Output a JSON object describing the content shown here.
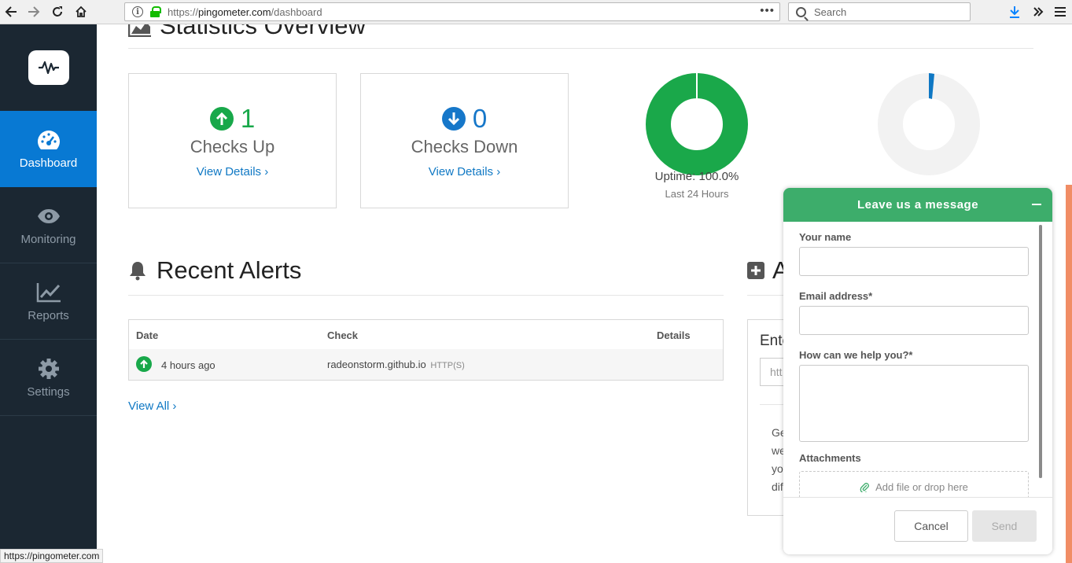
{
  "browser": {
    "url_prefix": "https://",
    "url_domain": "pingometer.com",
    "url_path": "/dashboard",
    "search_placeholder": "Search",
    "status_url": "https://pingometer.com"
  },
  "sidebar": {
    "items": [
      {
        "label": "Dashboard",
        "icon": "dashboard-gauge-icon",
        "active": true
      },
      {
        "label": "Monitoring",
        "icon": "eye-icon",
        "active": false
      },
      {
        "label": "Reports",
        "icon": "chart-icon",
        "active": false
      },
      {
        "label": "Settings",
        "icon": "gear-icon",
        "active": false
      }
    ]
  },
  "stats": {
    "heading": "Statistics Overview",
    "checks_up": {
      "count": "1",
      "label": "Checks Up",
      "link": "View Details ›"
    },
    "checks_down": {
      "count": "0",
      "label": "Checks Down",
      "link": "View Details ›"
    },
    "uptime": {
      "caption": "Uptime: 100.0%",
      "sub": "Last 24 Hours",
      "fraction": 1.0
    },
    "response": {
      "fraction": 0.02
    }
  },
  "alerts": {
    "title": "Recent Alerts",
    "columns": [
      "Date",
      "Check",
      "Details"
    ],
    "rows": [
      {
        "date": "4 hours ago",
        "check": "radeonstorm.github.io",
        "protocol": "HTTP(S)",
        "status": "up"
      }
    ],
    "view_all": "View All ›"
  },
  "add_check": {
    "title": "A",
    "enter": "Ente",
    "input_partial": "htt",
    "text_lines": [
      "Ge",
      "we",
      "yo",
      "dif"
    ]
  },
  "chat": {
    "title": "Leave us a message",
    "name_label": "Your name",
    "email_label": "Email address*",
    "help_label": "How can we help you?*",
    "attach_label": "Attachments",
    "drop_text": "Add file or drop here",
    "cancel": "Cancel",
    "send": "Send"
  },
  "colors": {
    "sidebar_bg": "#1b2732",
    "active_blue": "#0879d3",
    "up_green": "#18a84a",
    "down_blue": "#1677c9",
    "chat_green": "#3dad6b"
  }
}
